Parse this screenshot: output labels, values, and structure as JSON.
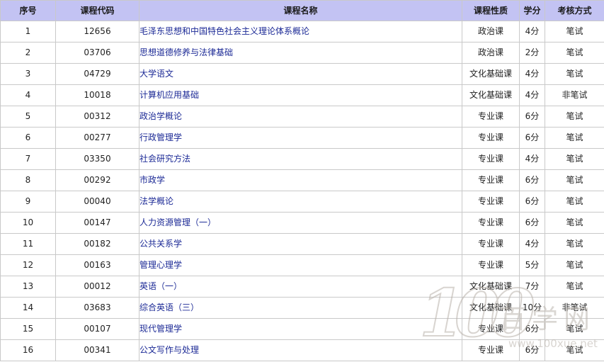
{
  "table": {
    "headers": [
      "序号",
      "课程代码",
      "课程名称",
      "课程性质",
      "学分",
      "考核方式"
    ],
    "rows": [
      [
        "1",
        "12656",
        "毛泽东思想和中国特色社会主义理论体系概论",
        "政治课",
        "4分",
        "笔试"
      ],
      [
        "2",
        "03706",
        "思想道德修养与法律基础",
        "政治课",
        "2分",
        "笔试"
      ],
      [
        "3",
        "04729",
        "大学语文",
        "文化基础课",
        "4分",
        "笔试"
      ],
      [
        "4",
        "10018",
        "计算机应用基础",
        "文化基础课",
        "4分",
        "非笔试"
      ],
      [
        "5",
        "00312",
        "政治学概论",
        "专业课",
        "6分",
        "笔试"
      ],
      [
        "6",
        "00277",
        "行政管理学",
        "专业课",
        "6分",
        "笔试"
      ],
      [
        "7",
        "03350",
        "社会研究方法",
        "专业课",
        "4分",
        "笔试"
      ],
      [
        "8",
        "00292",
        "市政学",
        "专业课",
        "6分",
        "笔试"
      ],
      [
        "9",
        "00040",
        "法学概论",
        "专业课",
        "6分",
        "笔试"
      ],
      [
        "10",
        "00147",
        "人力资源管理（一）",
        "专业课",
        "6分",
        "笔试"
      ],
      [
        "11",
        "00182",
        "公共关系学",
        "专业课",
        "4分",
        "笔试"
      ],
      [
        "12",
        "00163",
        "管理心理学",
        "专业课",
        "5分",
        "笔试"
      ],
      [
        "13",
        "00012",
        "英语（一）",
        "文化基础课",
        "7分",
        "笔试"
      ],
      [
        "14",
        "03683",
        "综合英语（三）",
        "文化基础课",
        "10分",
        "非笔试"
      ],
      [
        "15",
        "00107",
        "现代管理学",
        "专业课",
        "6分",
        "笔试"
      ],
      [
        "16",
        "00341",
        "公文写作与处理",
        "专业课",
        "6分",
        "笔试"
      ]
    ]
  },
  "watermark": {
    "digits": "100",
    "name": "百学网",
    "url": "www.100xue.net"
  },
  "colors": {
    "header_background": "#c3c3f3",
    "link_text": "#1c2a96",
    "grid_border": "#c9c9c9"
  }
}
